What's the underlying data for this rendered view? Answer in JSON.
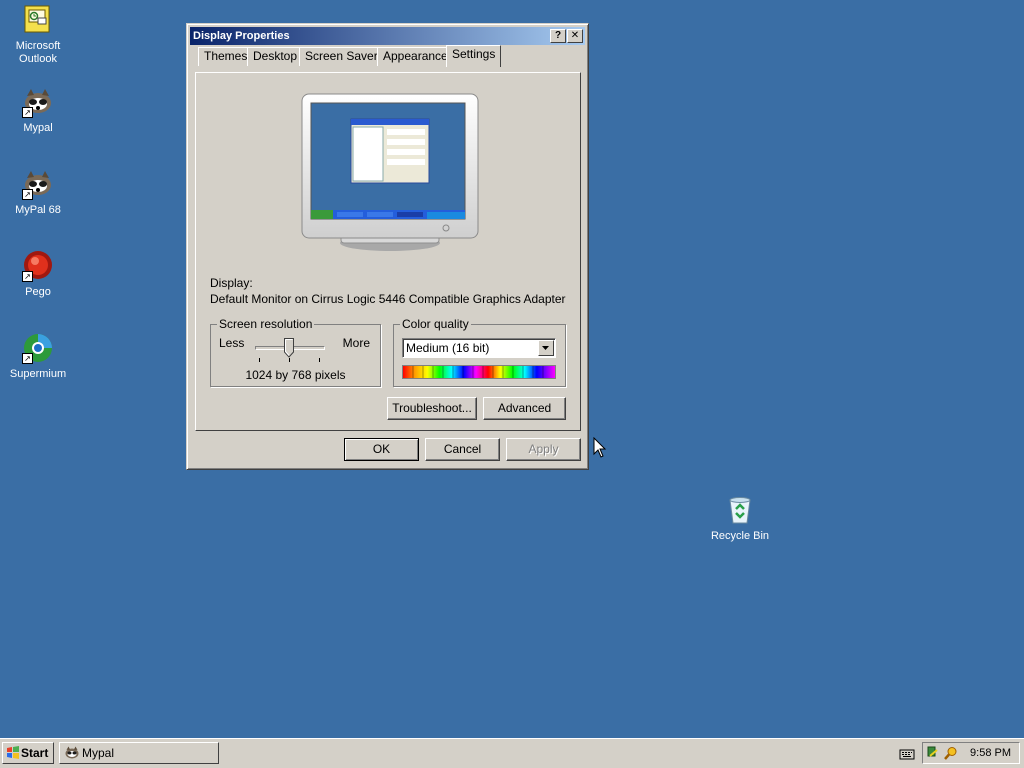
{
  "desktop": {
    "icons": [
      {
        "label": "Microsoft Outlook",
        "icon": "outlook-icon"
      },
      {
        "label": "Mypal",
        "icon": "mypal-icon"
      },
      {
        "label": "MyPal 68",
        "icon": "mypal68-icon"
      },
      {
        "label": "Pego",
        "icon": "pego-icon"
      },
      {
        "label": "Supermium",
        "icon": "supermium-icon"
      },
      {
        "label": "Recycle Bin",
        "icon": "recycle-bin-icon"
      }
    ]
  },
  "window": {
    "title": "Display Properties",
    "help_btn": "?",
    "close_btn": "✕",
    "tabs": [
      "Themes",
      "Desktop",
      "Screen Saver",
      "Appearance",
      "Settings"
    ],
    "active_tab": "Settings",
    "display_label": "Display:",
    "display_value": "Default Monitor on Cirrus Logic 5446 Compatible Graphics Adapter",
    "screen_resolution": {
      "legend": "Screen resolution",
      "less": "Less",
      "more": "More",
      "value_text": "1024 by 768 pixels",
      "slider_fraction": 0.5
    },
    "color_quality": {
      "legend": "Color quality",
      "selected": "Medium (16 bit)"
    },
    "buttons": {
      "troubleshoot": "Troubleshoot...",
      "advanced": "Advanced",
      "ok": "OK",
      "cancel": "Cancel",
      "apply": "Apply"
    }
  },
  "taskbar": {
    "start": "Start",
    "task": "Mypal",
    "clock": "9:58 PM"
  },
  "colors": {
    "desktop": "#3a6ea5",
    "titlebar_start": "#0a246a",
    "titlebar_end": "#a6caf0",
    "face": "#d4d0c8"
  }
}
